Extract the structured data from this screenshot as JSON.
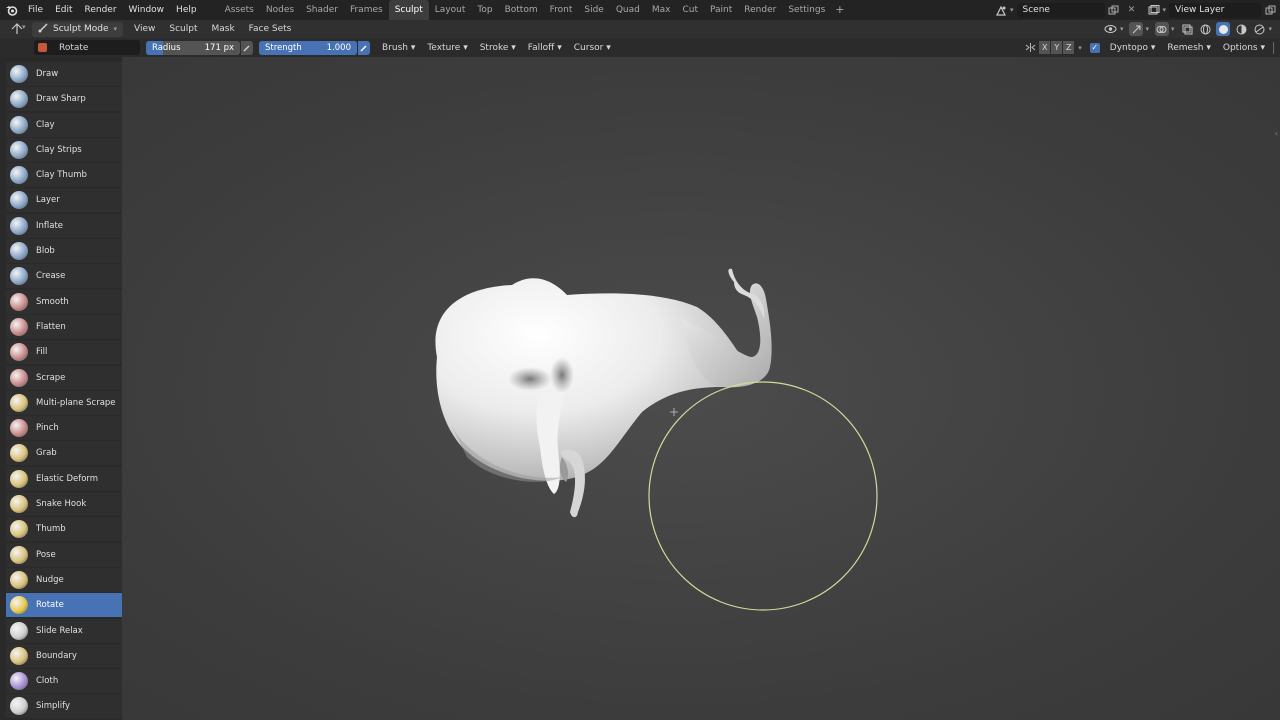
{
  "menu": [
    "File",
    "Edit",
    "Render",
    "Window",
    "Help"
  ],
  "workspaces": [
    "Assets",
    "Nodes",
    "Shader",
    "Frames",
    "Sculpt",
    "Layout",
    "Top",
    "Bottom",
    "Front",
    "Side",
    "Quad",
    "Max",
    "Cut",
    "Paint",
    "Render",
    "Settings"
  ],
  "active_workspace": "Sculpt",
  "add_workspace": "+",
  "scene": "Scene",
  "view_layer": "View Layer",
  "header": {
    "mode": "Sculpt Mode",
    "menus": [
      "View",
      "Sculpt",
      "Mask",
      "Face Sets"
    ]
  },
  "tool_settings": {
    "brush_name": "Rotate",
    "radius_label": "Radius",
    "radius_value": "171 px",
    "strength_label": "Strength",
    "strength_value": "1.000",
    "strength_fraction": 1.0,
    "radius_fraction": 0.18,
    "dropdowns": [
      "Brush",
      "Texture",
      "Stroke",
      "Falloff",
      "Cursor"
    ],
    "axes": [
      "X",
      "Y",
      "Z"
    ],
    "dyntopo": "Dyntopo",
    "remesh": "Remesh",
    "options": "Options"
  },
  "tools": [
    {
      "label": "Draw",
      "color": "#8aa7c8"
    },
    {
      "label": "Draw Sharp",
      "color": "#8aa7c8"
    },
    {
      "label": "Clay",
      "color": "#8aa7c8"
    },
    {
      "label": "Clay Strips",
      "color": "#8aa7c8"
    },
    {
      "label": "Clay Thumb",
      "color": "#8aa7c8"
    },
    {
      "label": "Layer",
      "color": "#8aa7c8"
    },
    {
      "label": "Inflate",
      "color": "#8aa7c8"
    },
    {
      "label": "Blob",
      "color": "#8aa7c8"
    },
    {
      "label": "Crease",
      "color": "#8aa7c8"
    },
    {
      "label": "Smooth",
      "color": "#c98a8a"
    },
    {
      "label": "Flatten",
      "color": "#c98a8a"
    },
    {
      "label": "Fill",
      "color": "#c98a8a"
    },
    {
      "label": "Scrape",
      "color": "#c98a8a"
    },
    {
      "label": "Multi-plane Scrape",
      "color": "#d9c27a"
    },
    {
      "label": "Pinch",
      "color": "#c98a8a"
    },
    {
      "label": "Grab",
      "color": "#d9c27a"
    },
    {
      "label": "Elastic Deform",
      "color": "#d9c27a"
    },
    {
      "label": "Snake Hook",
      "color": "#d9c27a"
    },
    {
      "label": "Thumb",
      "color": "#d9c27a"
    },
    {
      "label": "Pose",
      "color": "#d9c27a"
    },
    {
      "label": "Nudge",
      "color": "#d9c27a"
    },
    {
      "label": "Rotate",
      "color": "#e8c84a"
    },
    {
      "label": "Slide Relax",
      "color": "#cfcfcf"
    },
    {
      "label": "Boundary",
      "color": "#d9c27a"
    },
    {
      "label": "Cloth",
      "color": "#a78fd6"
    },
    {
      "label": "Simplify",
      "color": "#cfcfcf"
    }
  ],
  "active_tool": "Rotate",
  "colors": {
    "accent": "#4772b3",
    "brush_circle": "#e0e0a0"
  }
}
